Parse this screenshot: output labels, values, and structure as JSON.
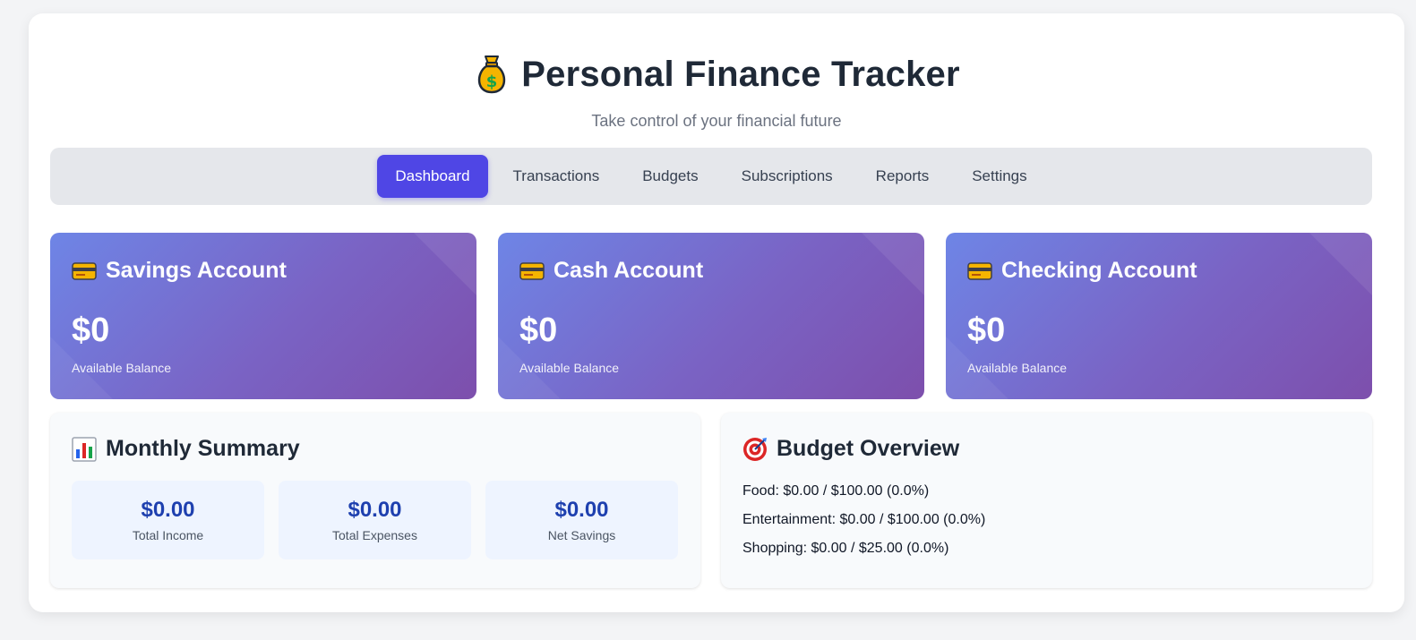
{
  "header": {
    "title": "Personal Finance Tracker",
    "subtitle": "Take control of your financial future",
    "icon": "money-bag-icon"
  },
  "nav": {
    "tabs": [
      {
        "label": "Dashboard",
        "active": true
      },
      {
        "label": "Transactions",
        "active": false
      },
      {
        "label": "Budgets",
        "active": false
      },
      {
        "label": "Subscriptions",
        "active": false
      },
      {
        "label": "Reports",
        "active": false
      },
      {
        "label": "Settings",
        "active": false
      }
    ],
    "active_color": "#4f46e5"
  },
  "accounts": [
    {
      "name": "Savings Account",
      "balance": "$0",
      "label": "Available Balance",
      "icon": "credit-card-icon"
    },
    {
      "name": "Cash Account",
      "balance": "$0",
      "label": "Available Balance",
      "icon": "credit-card-icon"
    },
    {
      "name": "Checking Account",
      "balance": "$0",
      "label": "Available Balance",
      "icon": "credit-card-icon"
    }
  ],
  "summary": {
    "title": "Monthly Summary",
    "icon": "bar-chart-icon",
    "stats": [
      {
        "value": "$0.00",
        "label": "Total Income"
      },
      {
        "value": "$0.00",
        "label": "Total Expenses"
      },
      {
        "value": "$0.00",
        "label": "Net Savings"
      }
    ]
  },
  "budget": {
    "title": "Budget Overview",
    "icon": "target-icon",
    "lines": [
      "Food: $0.00 / $100.00 (0.0%)",
      "Entertainment: $0.00 / $100.00 (0.0%)",
      "Shopping: $0.00 / $25.00 (0.0%)"
    ]
  }
}
